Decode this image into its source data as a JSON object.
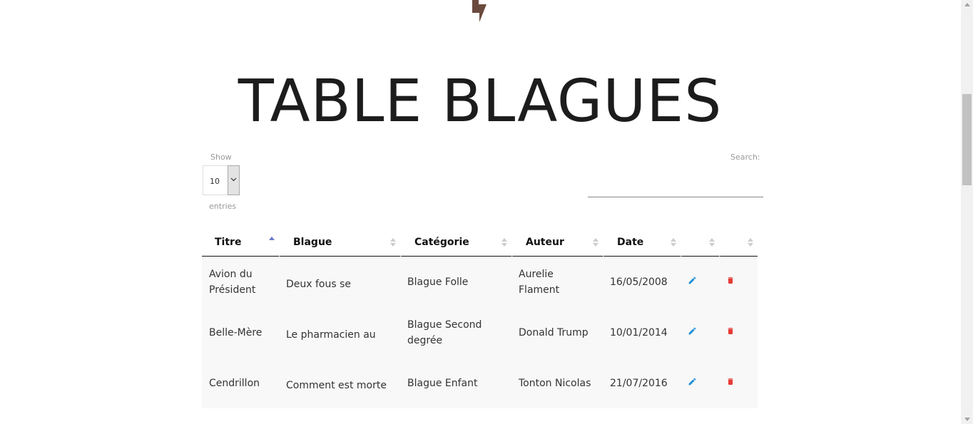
{
  "page": {
    "title": "TABLE BLAGUES"
  },
  "icons": {
    "logo": "lightning-bolt-icon",
    "edit": "pencil-icon",
    "delete": "trash-icon"
  },
  "colors": {
    "logo": "#6b4a3e",
    "edit": "#1e8fd6",
    "delete": "#e53935",
    "sort_active": "#6a78c8",
    "sort_inactive": "#cccccc"
  },
  "controls": {
    "show_label": "Show",
    "entries_label": "entries",
    "length_value": "10",
    "search_label": "Search:",
    "search_value": ""
  },
  "table": {
    "columns": [
      "Titre",
      "Blague",
      "Catégorie",
      "Auteur",
      "Date",
      "",
      ""
    ],
    "sorted_column": "Titre",
    "sort_direction": "asc",
    "rows": [
      {
        "titre": "Avion du Président",
        "blague": "Deux fous se",
        "categorie": "Blague Folle",
        "auteur": "Aurelie Flament",
        "date": "16/05/2008"
      },
      {
        "titre": "Belle-Mère",
        "blague": "Le pharmacien au",
        "categorie": "Blague Second degrée",
        "auteur": "Donald Trump",
        "date": "10/01/2014"
      },
      {
        "titre": "Cendrillon",
        "blague": "Comment est morte",
        "categorie": "Blague Enfant",
        "auteur": "Tonton Nicolas",
        "date": "21/07/2016"
      }
    ]
  }
}
